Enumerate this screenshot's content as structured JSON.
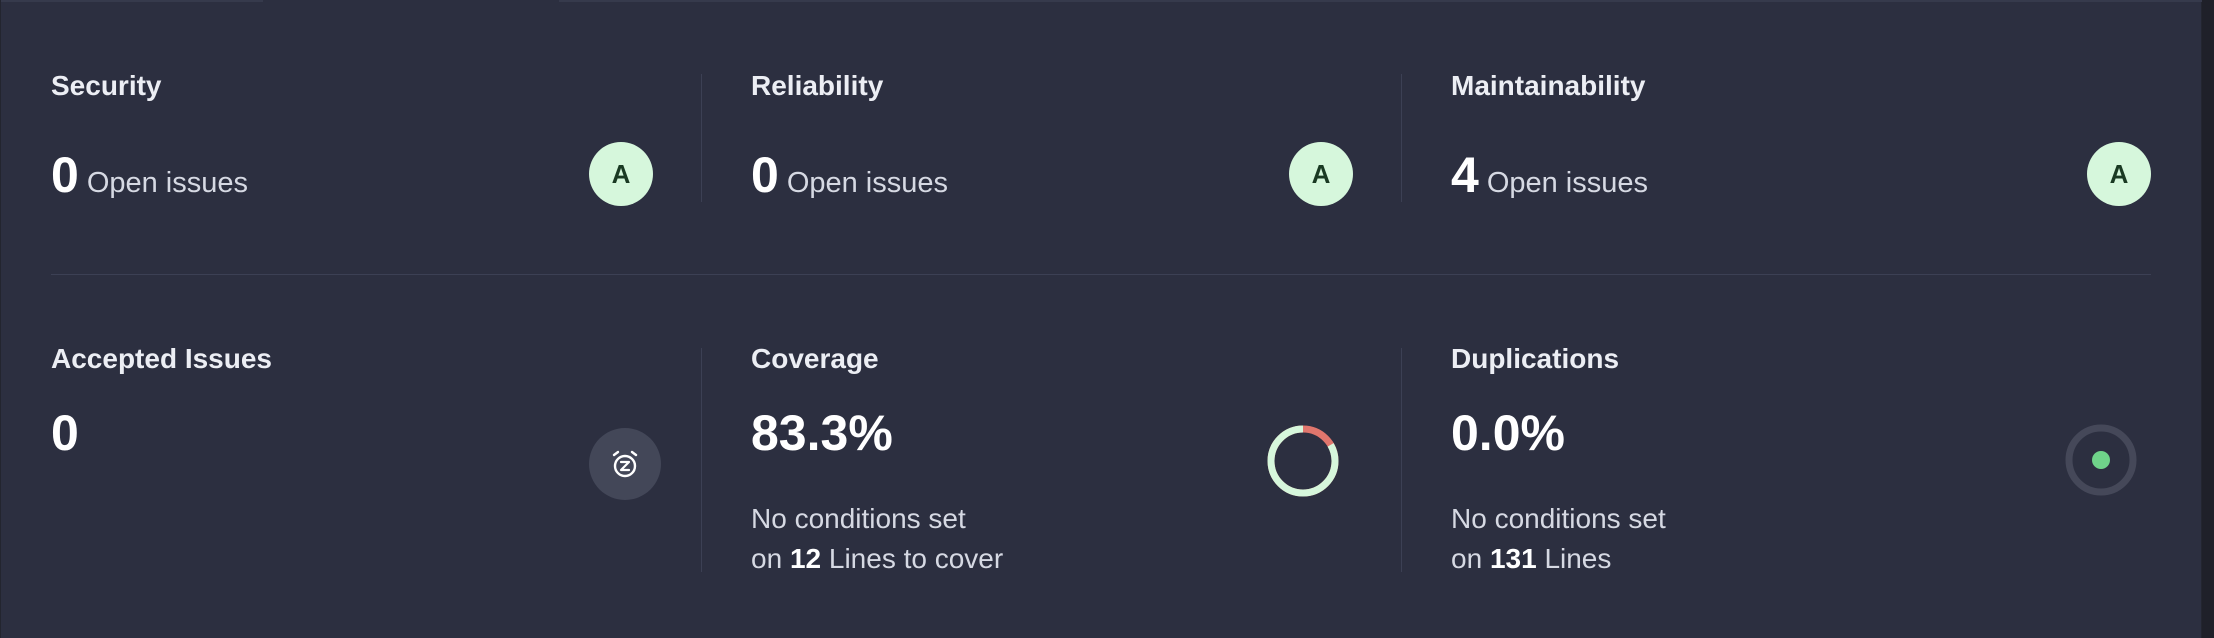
{
  "security": {
    "title": "Security",
    "count": "0",
    "suffix": "Open issues",
    "rating": "A"
  },
  "reliability": {
    "title": "Reliability",
    "count": "0",
    "suffix": "Open issues",
    "rating": "A"
  },
  "maintainability": {
    "title": "Maintainability",
    "count": "4",
    "suffix": "Open issues",
    "rating": "A"
  },
  "accepted": {
    "title": "Accepted Issues",
    "count": "0",
    "icon": "snooze-clock-icon"
  },
  "coverage": {
    "title": "Coverage",
    "value": "83.3%",
    "percent": 83.3,
    "note_line1": "No conditions set",
    "note_on": "on",
    "note_count": "12",
    "note_rest": "Lines to cover",
    "colors": {
      "covered": "#d6f7dc",
      "uncovered": "#e0766d"
    }
  },
  "duplications": {
    "title": "Duplications",
    "value": "0.0%",
    "note_line1": "No conditions set",
    "note_on": "on",
    "note_count": "131",
    "note_rest": "Lines",
    "colors": {
      "ring": "#454859",
      "dot": "#6fd38a"
    }
  },
  "colors": {
    "background": "#2c2f40",
    "rating_bg": "#d6f7dc",
    "rating_fg": "#1a3a23"
  }
}
